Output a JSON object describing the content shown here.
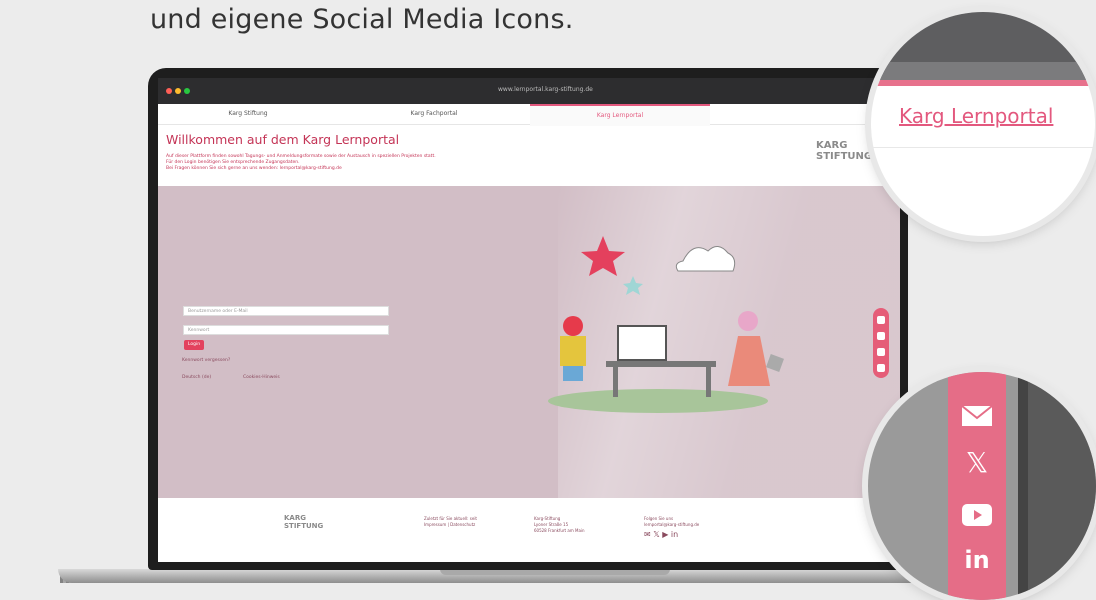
{
  "heading": "und eigene Social Media Icons.",
  "browser": {
    "url": "www.lernportal.karg-stiftung.de",
    "tabs": [
      "Karg Stiftung",
      "Karg Fachportal",
      "Karg Lernportal"
    ]
  },
  "page": {
    "title": "Willkommen auf dem Karg Lernportal",
    "intro": [
      "Auf dieser Plattform finden sowohl Tagungs- und Anmeldungsformate sowie der Austausch in speziellen Projekten statt.",
      "Für den Login benötigen Sie entsprechende Zugangsdaten.",
      "Bei Fragen können Sie sich gerne an uns wenden: lernportal@karg-stiftung.de"
    ],
    "logo": [
      "KARG",
      "STIFTUNG"
    ]
  },
  "login": {
    "username_placeholder": "Benutzername oder E-Mail",
    "password_placeholder": "Kennwort",
    "button": "Login",
    "forgot": "Kennwort vergessen?",
    "language": "Deutsch (de)",
    "cookie": "Cookies-Hinweis"
  },
  "footer": {
    "logo": [
      "KARG",
      "STIFTUNG"
    ],
    "col1": [
      "Zuletzt für Sie aktuell: seit",
      "Impressum | Datenschutz"
    ],
    "col2": [
      "Karg-Stiftung",
      "Lyoner Straße 15",
      "60528 Frankfurt am Main"
    ],
    "col3": [
      "Folgen Sie uns",
      "lernportal@karg-stiftung.de"
    ]
  },
  "magnifier_top": {
    "link": "Karg Lernportal"
  },
  "magnifier_bottom": {
    "icons": [
      "mail-icon",
      "x-icon",
      "youtube-icon",
      "linkedin-icon"
    ],
    "linkedin_label": "in",
    "x_label": "𝕏"
  },
  "colors": {
    "accent": "#e3587e",
    "hero": "#d2bec6",
    "social_bar": "#e56d87"
  }
}
